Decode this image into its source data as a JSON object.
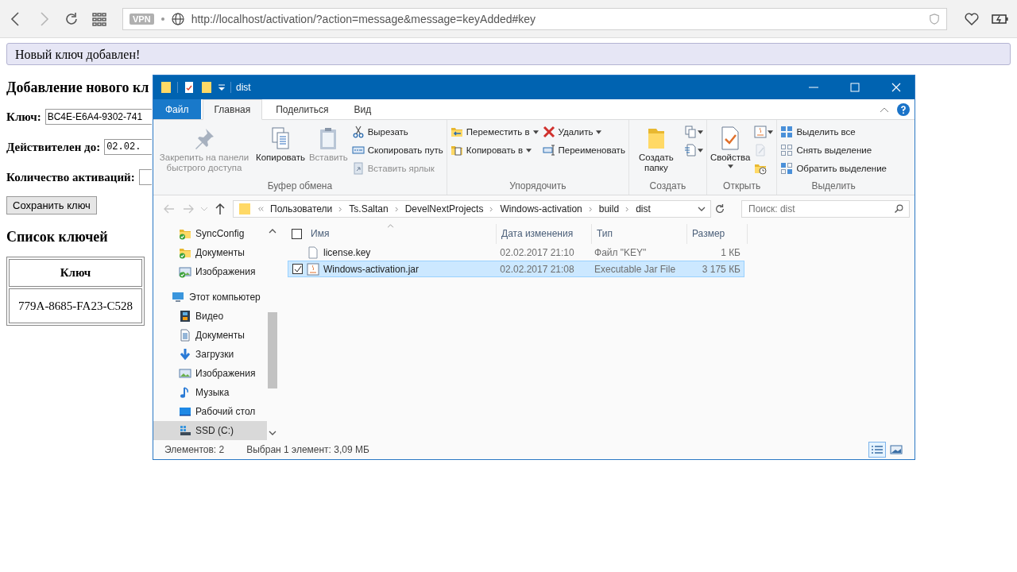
{
  "browser": {
    "vpn_badge": "VPN",
    "url": "http://localhost/activation/?action=message&message=keyAdded#key"
  },
  "page": {
    "message": "Новый ключ добавлен!",
    "heading": "Добавление нового кл",
    "fields": [
      {
        "label": "Ключ:",
        "value": "BC4E-E6A4-9302-741",
        "kind": "text"
      },
      {
        "label": "Действителен до:",
        "value": "02.02.",
        "kind": "date"
      },
      {
        "label": "Количество активаций:",
        "kind": "number"
      }
    ],
    "save_button": "Сохранить ключ",
    "list_heading": "Список ключей",
    "table": {
      "columns": [
        "Ключ"
      ],
      "rows": [
        [
          "779A-8685-FA23-C528"
        ]
      ]
    }
  },
  "explorer": {
    "title": "dist",
    "ribbon_tabs": [
      {
        "label": "Файл",
        "kind": "file",
        "selected": false
      },
      {
        "label": "Главная",
        "kind": "tab",
        "selected": true
      },
      {
        "label": "Поделиться",
        "kind": "tab",
        "selected": false
      },
      {
        "label": "Вид",
        "kind": "tab",
        "selected": false
      }
    ],
    "ribbon_groups": [
      {
        "label": "Буфер обмена",
        "columns": [
          [
            {
              "label": "Закрепить на панели быстрого доступа",
              "kind": "large",
              "disabled": true,
              "dropdown": false
            }
          ],
          [
            {
              "label": "Копировать",
              "kind": "large",
              "disabled": false,
              "dropdown": false
            }
          ],
          [
            {
              "label": "Вставить",
              "kind": "large",
              "disabled": true,
              "dropdown": false
            }
          ],
          [
            {
              "label": "Вырезать",
              "kind": "small",
              "disabled": false,
              "dropdown": false
            },
            {
              "label": "Скопировать путь",
              "kind": "small",
              "disabled": false,
              "dropdown": false
            },
            {
              "label": "Вставить ярлык",
              "kind": "small",
              "disabled": true,
              "dropdown": false
            }
          ]
        ]
      },
      {
        "label": "Упорядочить",
        "columns": [
          [
            {
              "label": "Переместить в",
              "kind": "small",
              "disabled": false,
              "dropdown": true
            },
            {
              "label": "Копировать в",
              "kind": "small",
              "disabled": false,
              "dropdown": true
            }
          ],
          [
            {
              "label": "Удалить",
              "kind": "small",
              "disabled": false,
              "dropdown": true
            },
            {
              "label": "Переименовать",
              "kind": "small",
              "disabled": false,
              "dropdown": false
            }
          ]
        ]
      },
      {
        "label": "Создать",
        "columns": [
          [
            {
              "label": "Создать папку",
              "kind": "large",
              "disabled": false,
              "dropdown": false
            }
          ],
          [
            {
              "kind": "icon",
              "disabled": false,
              "dropdown": true
            },
            {
              "kind": "icon",
              "disabled": false,
              "dropdown": true
            }
          ]
        ]
      },
      {
        "label": "Открыть",
        "columns": [
          [
            {
              "label": "Свойства",
              "kind": "large",
              "disabled": false,
              "dropdown": true
            }
          ],
          [
            {
              "kind": "icon",
              "disabled": false,
              "dropdown": true
            },
            {
              "kind": "icon",
              "disabled": true,
              "dropdown": false
            },
            {
              "kind": "icon",
              "disabled": false,
              "dropdown": false
            }
          ]
        ]
      },
      {
        "label": "Выделить",
        "columns": [
          [
            {
              "label": "Выделить все",
              "kind": "small",
              "disabled": false,
              "dropdown": false
            },
            {
              "label": "Снять выделение",
              "kind": "small",
              "disabled": false,
              "dropdown": false
            },
            {
              "label": "Обратить выделение",
              "kind": "small",
              "disabled": false,
              "dropdown": false
            }
          ]
        ]
      }
    ],
    "breadcrumbs": [
      "Пользователи",
      "Ts.Saltan",
      "DevelNextProjects",
      "Windows-activation",
      "build",
      "dist"
    ],
    "search": {
      "placeholder": "Поиск: dist"
    },
    "quick_access": [
      {
        "label": "SyncConfig",
        "selected": false
      },
      {
        "label": "Документы",
        "selected": false
      },
      {
        "label": "Изображения",
        "selected": false
      }
    ],
    "this_pc": {
      "label": "Этот компьютер",
      "selected": false,
      "children": [
        {
          "label": "Видео",
          "selected": false
        },
        {
          "label": "Документы",
          "selected": false
        },
        {
          "label": "Загрузки",
          "selected": false
        },
        {
          "label": "Изображения",
          "selected": false
        },
        {
          "label": "Музыка",
          "selected": false
        },
        {
          "label": "Рабочий стол",
          "selected": false
        },
        {
          "label": "SSD (C:)",
          "selected": true
        }
      ]
    },
    "columns": [
      "Имя",
      "Дата изменения",
      "Тип",
      "Размер"
    ],
    "select_all_checked": false,
    "files": [
      {
        "name": "license.key",
        "date": "02.02.2017 21:10",
        "type": "Файл \"KEY\"",
        "size": "1 КБ",
        "kind": "file",
        "selected": false
      },
      {
        "name": "Windows-activation.jar",
        "date": "02.02.2017 21:08",
        "type": "Executable Jar File",
        "size": "3 175 КБ",
        "kind": "jar",
        "selected": true
      }
    ],
    "status": {
      "count": "Элементов: 2",
      "selection": "Выбран 1 элемент: 3,09 МБ"
    },
    "view_modes": [
      {
        "selected": true
      },
      {
        "selected": false
      }
    ]
  }
}
